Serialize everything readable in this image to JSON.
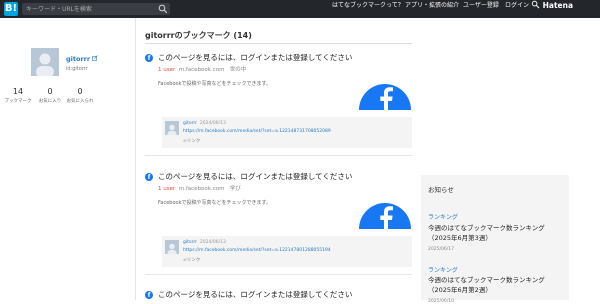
{
  "header": {
    "logo": "B!",
    "search_placeholder": "キーワード・URLを検索",
    "nav": [
      "はてなブックマークって？",
      "アプリ・拡張の紹介",
      "ユーザー登録",
      "ログイン"
    ],
    "brand": "Hatena"
  },
  "profile": {
    "name": "gitorrr",
    "id": "id:gitorrr",
    "stats": [
      {
        "value": "14",
        "label": "ブックマーク"
      },
      {
        "value": "0",
        "label": "お気に入り"
      },
      {
        "value": "0",
        "label": "お気に入られ"
      }
    ]
  },
  "main": {
    "title": "gitorrrのブックマーク (14)",
    "entries": [
      {
        "title": "このページを見るには、ログインまたは登録してください",
        "users": "1 user",
        "domain": "m.facebook.com",
        "tag": "世の中",
        "description": "Facebookで投稿や写真などをチェックできます。",
        "comment_user": "gitorrr",
        "comment_date": "2024/06/13",
        "comment_url": "https://m.facebook.com/media/set/?set=a.122148731708052089",
        "link_label": "リンク"
      },
      {
        "title": "このページを見るには、ログインまたは登録してください",
        "users": "1 user",
        "domain": "m.facebook.com",
        "tag": "学び",
        "description": "Facebookで投稿や写真などをチェックできます。",
        "comment_user": "gitorrr",
        "comment_date": "2024/06/13",
        "comment_url": "https://m.facebook.com/media/set/?set=a.122147801288055194",
        "link_label": "リンク"
      },
      {
        "title": "このページを見るには、ログインまたは登録してください"
      }
    ]
  },
  "notices": {
    "title": "お知らせ",
    "items": [
      {
        "category": "ランキング",
        "text": "今週のはてなブックマーク数ランキング （2025年6月第3週）",
        "date": "2025/06/17"
      },
      {
        "category": "ランキング",
        "text": "今週のはてなブックマーク数ランキング （2025年6月第2週）",
        "date": "2025/06/10"
      }
    ]
  },
  "colors": {
    "header_bg": "#23262b",
    "logo_bg": "#00a4de",
    "link": "#2a7bc1",
    "users": "#e8463b",
    "facebook": "#1877f2"
  }
}
